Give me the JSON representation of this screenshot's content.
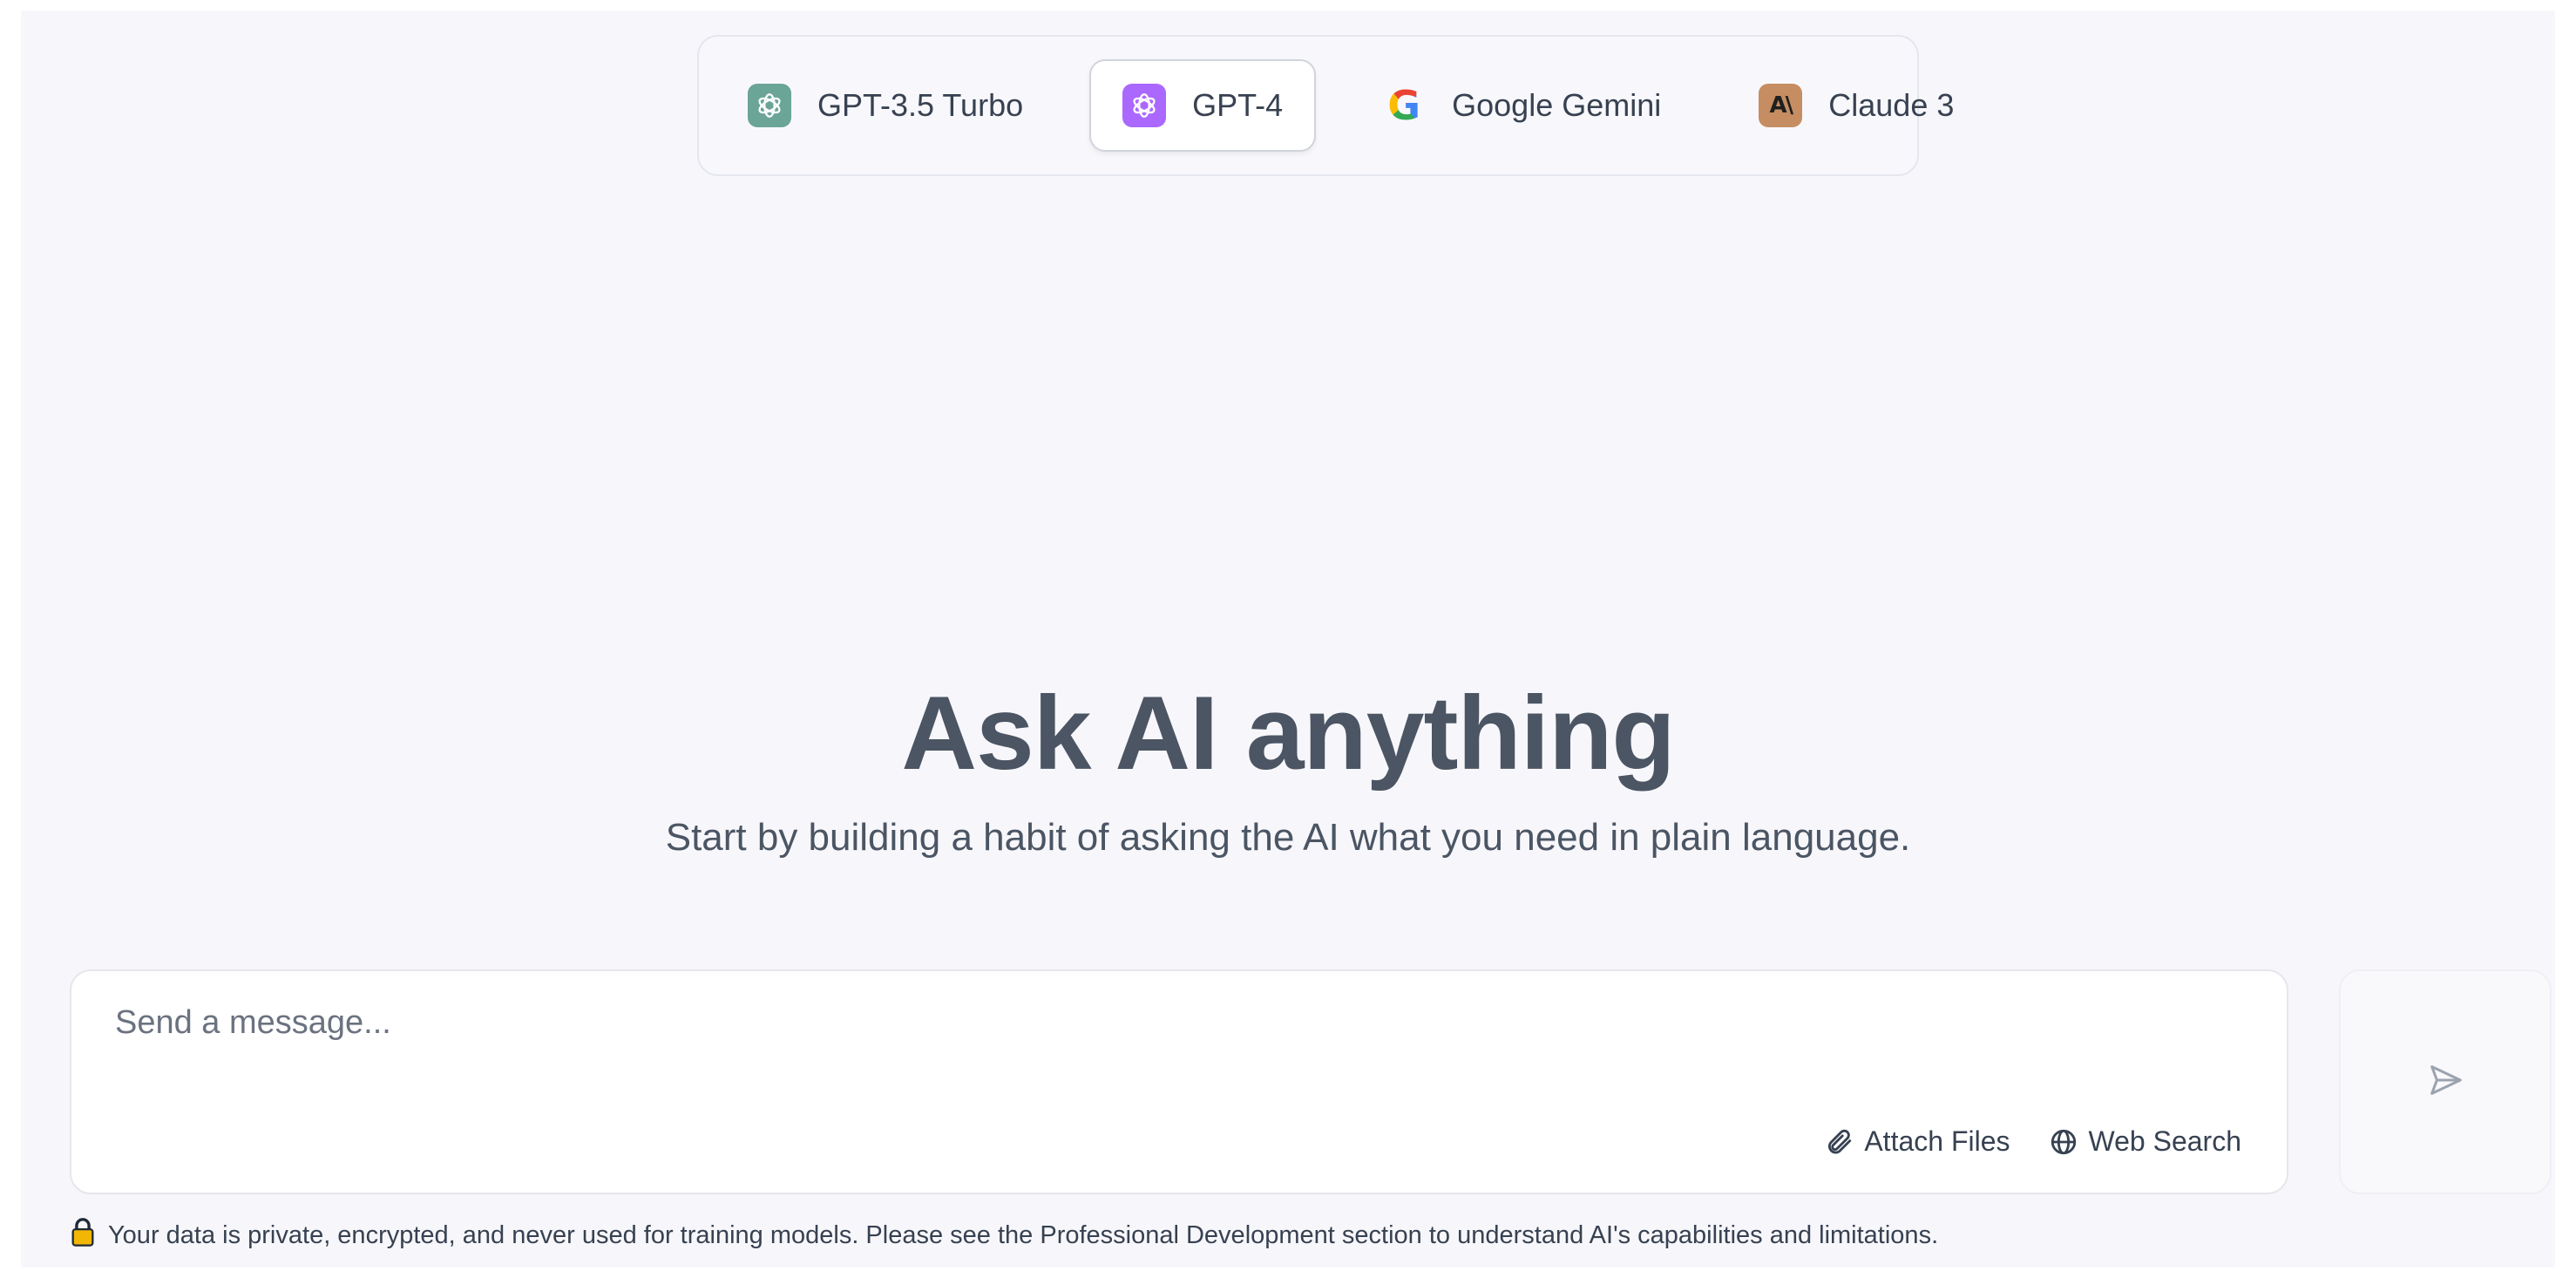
{
  "model_selector": {
    "tabs": [
      {
        "label": "GPT-3.5 Turbo",
        "icon": "openai-icon",
        "active": false
      },
      {
        "label": "GPT-4",
        "icon": "openai-icon",
        "active": true
      },
      {
        "label": "Google Gemini",
        "icon": "google-g-icon",
        "active": false
      },
      {
        "label": "Claude 3",
        "icon": "anthropic-icon",
        "active": false
      }
    ],
    "claude_logo_text": "A\\"
  },
  "hero": {
    "title": "Ask AI anything",
    "subtitle": "Start by building a habit of asking the AI what you need in plain language."
  },
  "composer": {
    "placeholder": "Send a message...",
    "value": "",
    "attach_label": "Attach Files",
    "web_search_label": "Web Search"
  },
  "footer": {
    "disclaimer": "Your data is private, encrypted, and never used for training models. Please see the Professional Development section to understand AI's capabilities and limitations."
  },
  "colors": {
    "gpt35_icon": "#6aa597",
    "gpt4_icon": "#ab68ff",
    "claude_icon": "#c68d62",
    "heading": "#4b5563",
    "lock": "#f2b705"
  }
}
